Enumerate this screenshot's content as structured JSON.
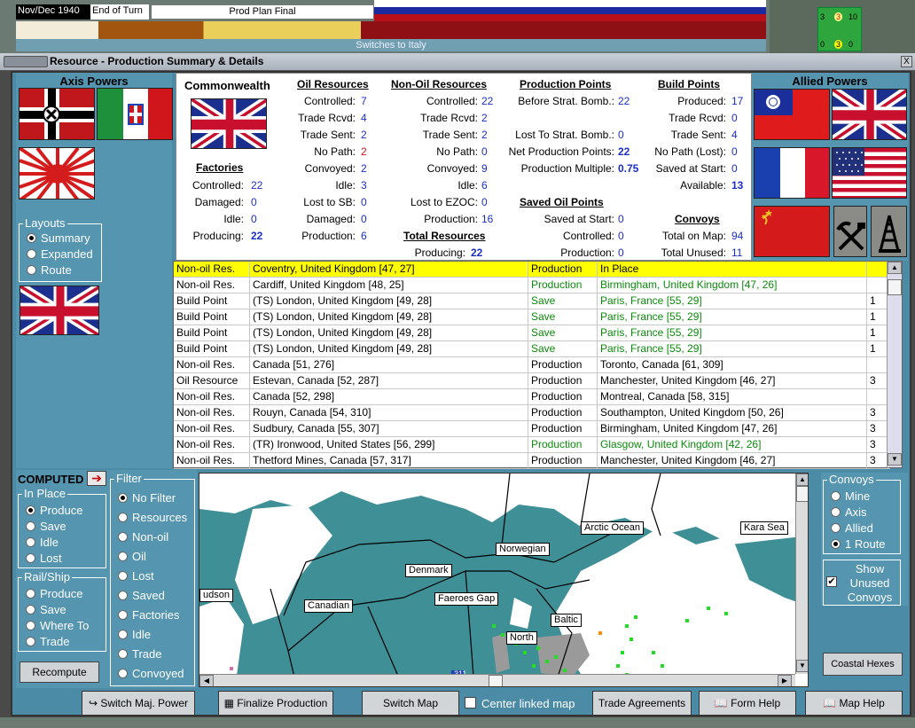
{
  "top": {
    "date": "Nov/Dec 1940",
    "end_of_turn": "End of Turn",
    "prod_plan": "Prod Plan Final",
    "switches": "Switches to Italy",
    "mini": [
      "3",
      "3",
      "10",
      "0",
      "3",
      "0"
    ]
  },
  "window": {
    "title": "Resource - Production Summary & Details",
    "close": "X"
  },
  "axis": {
    "title": "Axis Powers",
    "layouts_label": "Layouts",
    "layouts": [
      "Summary",
      "Expanded",
      "Route"
    ],
    "layouts_selected": 0
  },
  "allied": {
    "title": "Allied Powers"
  },
  "summary": {
    "nation": "Commonwealth",
    "factories": {
      "header": "Factories",
      "rows": [
        [
          "Controlled:",
          "22"
        ],
        [
          "Damaged:",
          "0"
        ],
        [
          "Idle:",
          "0"
        ],
        [
          "Producing:",
          "22"
        ]
      ]
    },
    "oil": {
      "header": "Oil Resources",
      "rows": [
        [
          "Controlled:",
          "7"
        ],
        [
          "Trade Rcvd:",
          "4"
        ],
        [
          "Trade Sent:",
          "2"
        ],
        [
          "No Path:",
          "2"
        ],
        [
          "Convoyed:",
          "2"
        ],
        [
          "Idle:",
          "3"
        ],
        [
          "Lost to SB:",
          "0"
        ],
        [
          "Damaged:",
          "0"
        ],
        [
          "Production:",
          "6"
        ]
      ]
    },
    "nonoil": {
      "header": "Non-Oil Resources",
      "rows": [
        [
          "Controlled:",
          "22"
        ],
        [
          "Trade Rcvd:",
          "2"
        ],
        [
          "Trade Sent:",
          "2"
        ],
        [
          "No Path:",
          "0"
        ],
        [
          "Convoyed:",
          "9"
        ],
        [
          "Idle:",
          "6"
        ],
        [
          "Lost to EZOC:",
          "0"
        ],
        [
          "Production:",
          "16"
        ]
      ]
    },
    "total": {
      "header": "Total Resources",
      "label": "Producing:",
      "value": "22"
    },
    "pp": {
      "header": "Production Points",
      "before_label": "Before Strat. Bomb.:",
      "before": "22",
      "lost_label": "Lost To Strat. Bomb.:",
      "lost": "0",
      "net_label": "Net Production Points:",
      "net": "22",
      "mult_label": "Production Multiple:",
      "mult": "0.75"
    },
    "saved_oil": {
      "header": "Saved Oil Points",
      "rows": [
        [
          "Saved at Start:",
          "0"
        ],
        [
          "Controlled:",
          "0"
        ],
        [
          "Production:",
          "0"
        ]
      ]
    },
    "bp": {
      "header": "Build Points",
      "rows": [
        [
          "Produced:",
          "17"
        ],
        [
          "Trade Rcvd:",
          "0"
        ],
        [
          "Trade Sent:",
          "4"
        ],
        [
          "No Path (Lost):",
          "0"
        ],
        [
          "Saved at Start:",
          "0"
        ],
        [
          "Available:",
          "13"
        ]
      ]
    },
    "convoys": {
      "header": "Convoys",
      "rows": [
        [
          "Total on Map:",
          "94"
        ],
        [
          "Total Unused:",
          "11"
        ]
      ]
    }
  },
  "table": {
    "rows": [
      {
        "type": "Non-oil Res.",
        "loc": "Coventry, United Kingdom [47, 27]",
        "action": "Production",
        "dest": "In Place",
        "n": "",
        "green": false,
        "hl": true
      },
      {
        "type": "Non-oil Res.",
        "loc": "Cardiff, United Kingdom [48, 25]",
        "action": "Production",
        "dest": "Birmingham, United Kingdom [47, 26]",
        "n": "",
        "green": true,
        "hl": false
      },
      {
        "type": "Build Point",
        "loc": "(TS) London, United Kingdom [49, 28]",
        "action": "Save",
        "dest": "Paris, France [55, 29]",
        "n": "1",
        "green": true,
        "hl": false
      },
      {
        "type": "Build Point",
        "loc": "(TS) London, United Kingdom [49, 28]",
        "action": "Save",
        "dest": "Paris, France [55, 29]",
        "n": "1",
        "green": true,
        "hl": false
      },
      {
        "type": "Build Point",
        "loc": "(TS) London, United Kingdom [49, 28]",
        "action": "Save",
        "dest": "Paris, France [55, 29]",
        "n": "1",
        "green": true,
        "hl": false
      },
      {
        "type": "Build Point",
        "loc": "(TS) London, United Kingdom [49, 28]",
        "action": "Save",
        "dest": "Paris, France [55, 29]",
        "n": "1",
        "green": true,
        "hl": false
      },
      {
        "type": "Non-oil Res.",
        "loc": "Canada [51, 276]",
        "action": "Production",
        "dest": "Toronto, Canada [61, 309]",
        "n": "",
        "green": false,
        "hl": false
      },
      {
        "type": "Oil Resource",
        "loc": "Estevan, Canada [52, 287]",
        "action": "Production",
        "dest": "Manchester, United Kingdom [46, 27]",
        "n": "3",
        "green": false,
        "hl": false
      },
      {
        "type": "Non-oil Res.",
        "loc": "Canada [52, 298]",
        "action": "Production",
        "dest": "Montreal, Canada [58, 315]",
        "n": "",
        "green": false,
        "hl": false
      },
      {
        "type": "Non-oil Res.",
        "loc": "Rouyn, Canada [54, 310]",
        "action": "Production",
        "dest": "Southampton, United Kingdom [50, 26]",
        "n": "3",
        "green": false,
        "hl": false
      },
      {
        "type": "Non-oil Res.",
        "loc": "Sudbury, Canada [55, 307]",
        "action": "Production",
        "dest": "Birmingham, United Kingdom [47, 26]",
        "n": "3",
        "green": false,
        "hl": false
      },
      {
        "type": "Non-oil Res.",
        "loc": "(TR) Ironwood, United States [56, 299]",
        "action": "Production",
        "dest": "Glasgow, United Kingdom [42, 26]",
        "n": "3",
        "green": true,
        "hl": false
      },
      {
        "type": "Non-oil Res.",
        "loc": "Thetford Mines, Canada [57, 317]",
        "action": "Production",
        "dest": "Manchester, United Kingdom [46, 27]",
        "n": "3",
        "green": false,
        "hl": false
      }
    ]
  },
  "left_controls": {
    "computed": "COMPUTED",
    "inplace_label": "In Place",
    "inplace": [
      "Produce",
      "Save",
      "Idle",
      "Lost"
    ],
    "inplace_selected": 0,
    "railship_label": "Rail/Ship",
    "railship": [
      "Produce",
      "Save",
      "Where To",
      "Trade"
    ],
    "filter_label": "Filter",
    "filter": [
      "No Filter",
      "Resources",
      "Non-oil",
      "Oil",
      "Lost",
      "Saved",
      "Factories",
      "Idle",
      "Trade",
      "Convoyed"
    ],
    "filter_selected": 0,
    "recompute": "Recompute"
  },
  "map": {
    "labels": [
      "Arctic Ocean",
      "Kara Sea",
      "Norwegian",
      "Denmark",
      "Canadian",
      "Faeroes Gap",
      "udson",
      "Baltic",
      "North",
      "311"
    ]
  },
  "convoys_panel": {
    "label": "Convoys",
    "options": [
      "Mine",
      "Axis",
      "Allied",
      "1 Route"
    ],
    "selected": 3,
    "show_unused": "Show Unused Convoys",
    "coastal": "Coastal Hexes"
  },
  "buttons": {
    "switch_major": "Switch Maj. Power",
    "finalize": "Finalize Production",
    "switch_map": "Switch Map",
    "center_linked": "Center linked map",
    "trade": "Trade Agreements",
    "form_help": "Form Help",
    "map_help": "Map Help"
  },
  "colors": {
    "panel": "#5595b0",
    "map_sea": "#3f8f97",
    "highlight": "#ffff00",
    "value_blue": "#1a2fc7",
    "route_green": "#0b8a0b"
  }
}
